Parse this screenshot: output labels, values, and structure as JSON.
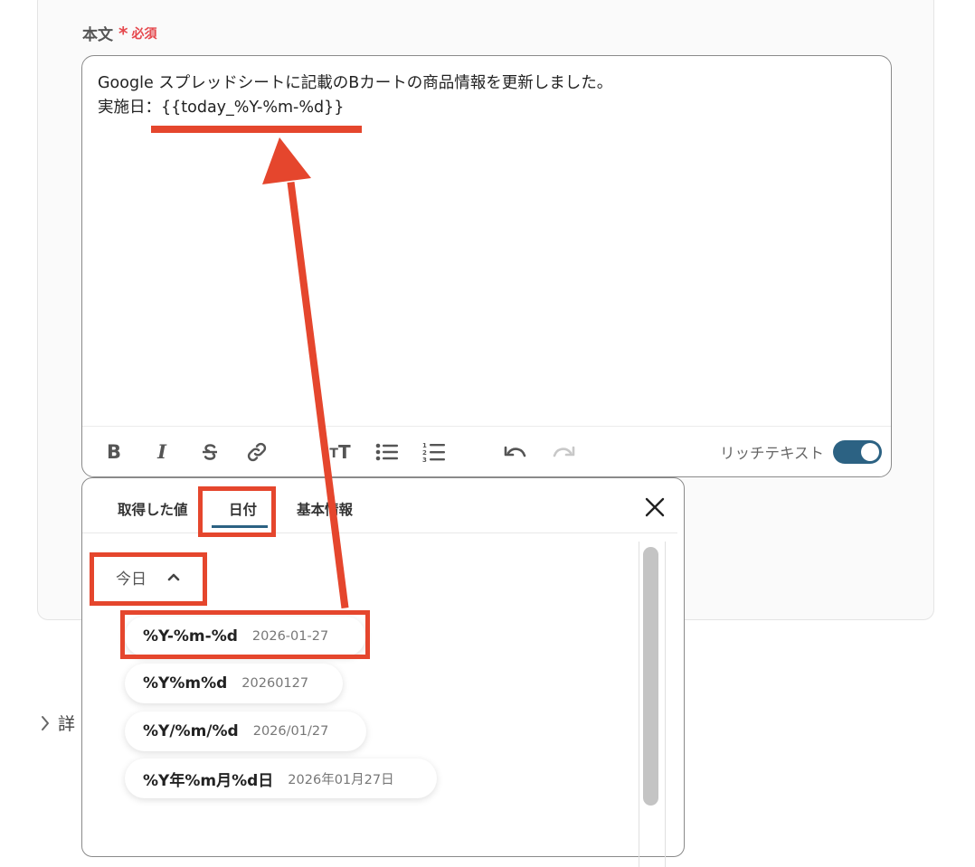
{
  "field": {
    "label": "本文",
    "required_star": "*",
    "required_text": "必須"
  },
  "editor": {
    "line1": "Google スプレッドシートに記載のBカートの商品情報を更新しました。",
    "line2": "実施日：{{today_%Y-%m-%d}}"
  },
  "toolbar": {
    "icons": [
      "bold-icon",
      "italic-icon",
      "strikethrough-icon",
      "link-icon",
      "text-size-icon",
      "bullet-list-icon",
      "numbered-list-icon",
      "undo-icon",
      "redo-icon"
    ],
    "bold": "B",
    "italic": "I",
    "text_size": "T",
    "rich_text_label": "リッチテキスト",
    "rich_text_enabled": true
  },
  "details_label": "詳",
  "popup": {
    "tabs": [
      "取得した値",
      "日付",
      "基本情報"
    ],
    "active_tab": "日付",
    "group_header": "今日",
    "options": [
      {
        "format": "%Y-%m-%d",
        "example": "2026-01-27"
      },
      {
        "format": "%Y%m%d",
        "example": "20260127"
      },
      {
        "format": "%Y/%m/%d",
        "example": "2026/01/27"
      },
      {
        "format": "%Y年%m月%d日",
        "example": "2026年01月27日"
      }
    ]
  },
  "colors": {
    "annotation": "#e5462d",
    "accent": "#2c6283",
    "required": "#e5484d"
  }
}
